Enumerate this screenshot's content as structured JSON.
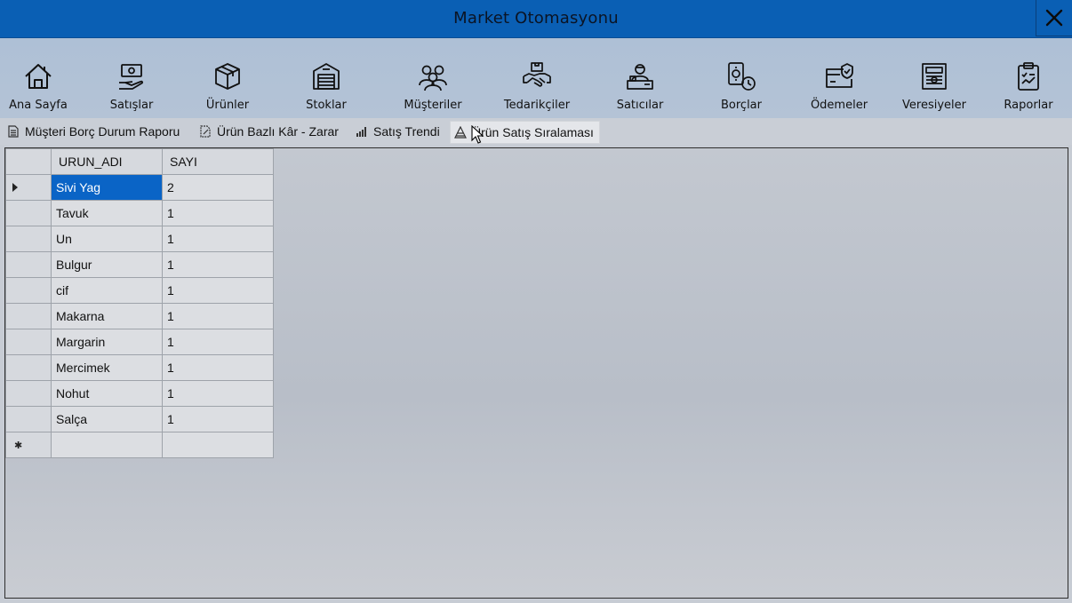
{
  "window": {
    "title": "Market Otomasyonu",
    "close_icon": "close-icon"
  },
  "toolbar": {
    "items": [
      {
        "label": "Ana Sayfa",
        "icon": "home-icon"
      },
      {
        "label": "Satışlar",
        "icon": "sales-hand-money-icon"
      },
      {
        "label": "Ürünler",
        "icon": "product-box-icon"
      },
      {
        "label": "Stoklar",
        "icon": "warehouse-icon"
      },
      {
        "label": "Müşteriler",
        "icon": "customers-icon"
      },
      {
        "label": "Tedarikçiler",
        "icon": "handshake-icon"
      },
      {
        "label": "Satıcılar",
        "icon": "seller-icon"
      },
      {
        "label": "Borçlar",
        "icon": "debt-money-clock-icon"
      },
      {
        "label": "Ödemeler",
        "icon": "payment-card-check-icon"
      },
      {
        "label": "Veresiyeler",
        "icon": "credit-ledger-icon"
      },
      {
        "label": "Raporlar",
        "icon": "report-clipboard-icon"
      }
    ]
  },
  "tabs": [
    {
      "label": "Müşteri Borç Durum Raporu",
      "icon": "document-icon"
    },
    {
      "label": "Ürün Bazlı Kâr - Zarar",
      "icon": "edit-document-icon"
    },
    {
      "label": "Satış Trendi",
      "icon": "bar-chart-icon"
    },
    {
      "label": "Ürün Satış Sıralaması",
      "icon": "pyramid-icon",
      "active": true
    }
  ],
  "grid": {
    "columns": [
      "URUN_ADI",
      "SAYI"
    ],
    "rows": [
      [
        "Sivi Yag",
        "2"
      ],
      [
        "Tavuk",
        "1"
      ],
      [
        "Un",
        "1"
      ],
      [
        "Bulgur",
        "1"
      ],
      [
        "cif",
        "1"
      ],
      [
        "Makarna",
        "1"
      ],
      [
        "Margarin",
        "1"
      ],
      [
        "Mercimek",
        "1"
      ],
      [
        "Nohut",
        "1"
      ],
      [
        "Salça",
        "1"
      ]
    ],
    "selected_row": 0
  }
}
